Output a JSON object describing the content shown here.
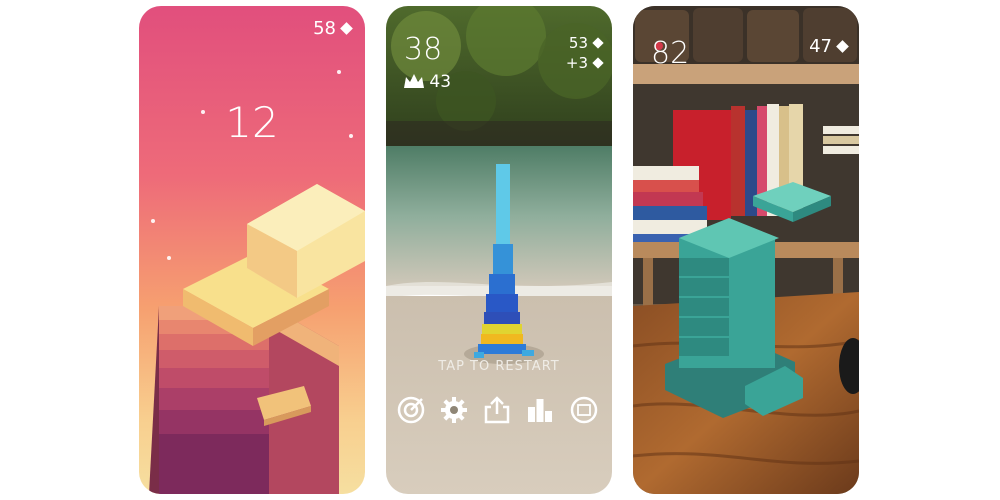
{
  "screens": [
    {
      "score": "12",
      "gems": "58"
    },
    {
      "score": "38",
      "best": "43",
      "gems": "53",
      "gems_gain": "+3",
      "prompt": "TAP TO RESTART"
    },
    {
      "score": "82",
      "gems": "47"
    }
  ],
  "controls": [
    {
      "icon": "target-icon"
    },
    {
      "icon": "gear-icon"
    },
    {
      "icon": "share-icon"
    },
    {
      "icon": "leaderboard-icon"
    },
    {
      "icon": "ar-mode-icon"
    }
  ],
  "colors": {
    "screen1_bg_top": "#e14f7d",
    "screen1_bg_bottom": "#f6dfa0",
    "tower_blue": "#1f6fd1",
    "tower_teal": "#3eaa98"
  }
}
